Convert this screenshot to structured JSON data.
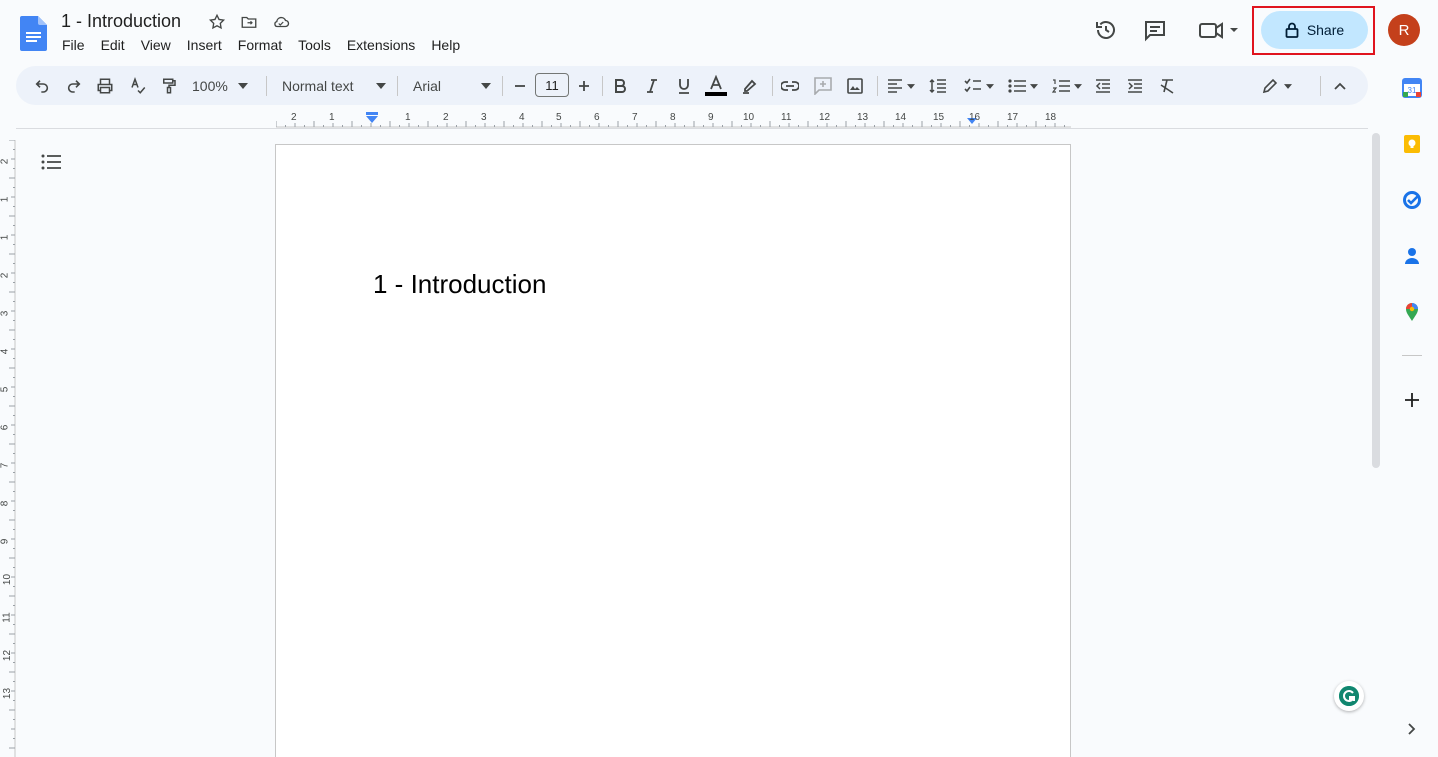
{
  "document": {
    "title": "1 - Introduction",
    "heading": "1 - Introduction"
  },
  "menu": [
    "File",
    "Edit",
    "View",
    "Insert",
    "Format",
    "Tools",
    "Extensions",
    "Help"
  ],
  "toolbar": {
    "zoom": "100%",
    "style": "Normal text",
    "font": "Arial",
    "font_size": "11"
  },
  "share": {
    "label": "Share"
  },
  "user": {
    "avatar_letter": "R"
  },
  "ruler": {
    "horizontal": [
      "2",
      "1",
      "1",
      "2",
      "3",
      "4",
      "5",
      "6",
      "7",
      "8",
      "9",
      "10",
      "11",
      "12",
      "13",
      "14",
      "15",
      "16",
      "17",
      "18"
    ],
    "vertical": [
      "2",
      "1",
      "1",
      "2",
      "3",
      "4",
      "5",
      "6",
      "7",
      "8",
      "9",
      "10",
      "11",
      "12",
      "13"
    ]
  },
  "side_panel": {
    "calendar_day": "31"
  },
  "colors": {
    "accent": "#0b57d0",
    "share_bg": "#c2e7ff",
    "highlight": "#e0141e",
    "avatar": "#c4401b"
  }
}
